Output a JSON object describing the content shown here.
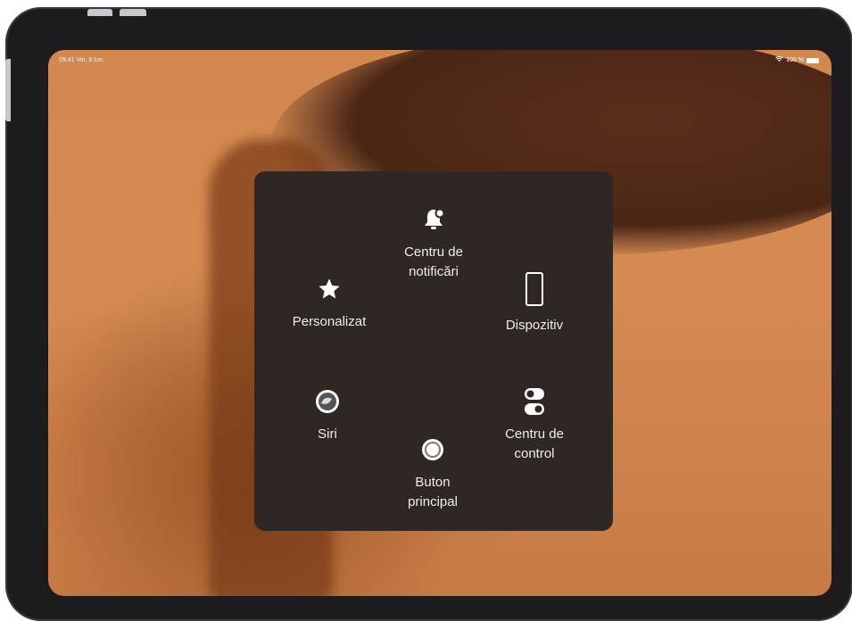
{
  "status_bar": {
    "time": "09:41  Vin. 5 Iun.",
    "battery": "100 %"
  },
  "assistive_menu": {
    "items": [
      {
        "id": "notification_center",
        "label": "Centru de\nnotificări",
        "icon": "bell-icon"
      },
      {
        "id": "custom",
        "label": "Personalizat",
        "icon": "star-icon"
      },
      {
        "id": "device",
        "label": "Dispozitiv",
        "icon": "device-icon"
      },
      {
        "id": "siri",
        "label": "Siri",
        "icon": "siri-icon"
      },
      {
        "id": "control_center",
        "label": "Centru de\ncontrol",
        "icon": "toggle-icon"
      },
      {
        "id": "home",
        "label": "Buton\nprincipal",
        "icon": "home-button-icon"
      }
    ]
  },
  "colors": {
    "menu_bg": "#2e2723",
    "text": "#eeeeee",
    "bezel": "#1c1c1e"
  }
}
